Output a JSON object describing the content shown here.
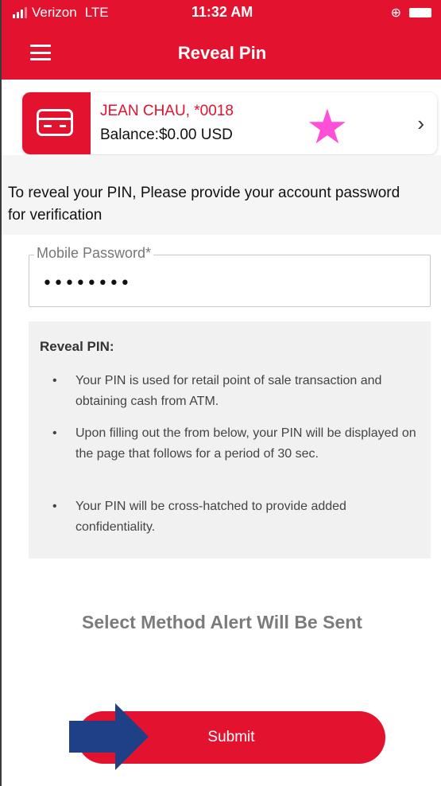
{
  "status_bar": {
    "carrier": "Verizon",
    "network": "LTE",
    "time": "11:32 AM",
    "lock_icon": "orientation-lock-icon",
    "battery_icon": "battery-icon"
  },
  "nav": {
    "menu_icon": "hamburger-menu-icon",
    "title": "Reveal Pin"
  },
  "account": {
    "name": "JEAN CHAU, *0018",
    "balance": "Balance:$0.00 USD",
    "icon": "credit-card-icon",
    "chevron": "chevron-right-icon"
  },
  "annotation": {
    "star_icon": "star-icon",
    "star_color": "#ff4fd8",
    "arrow_icon": "arrow-right-icon",
    "arrow_color": "#1f3f86"
  },
  "instruction": "To reveal your PIN, Please provide your account password for verification",
  "password_field": {
    "label": "Mobile Password*",
    "value": "••••••••"
  },
  "info": {
    "title": "Reveal PIN:",
    "items": [
      "Your PIN is used for retail point of sale transaction and obtaining cash from ATM.",
      "Upon filling out the from below, your PIN will be displayed on the page that follows for a period of 30 sec.",
      "Your PIN will be cross-hatched to provide added confidentiality."
    ]
  },
  "alert_method_title": "Select Method Alert Will Be Sent",
  "submit_label": "Submit",
  "colors": {
    "brand": "#e3122e",
    "background": "#ffffff",
    "panel": "#f1f1f1"
  }
}
